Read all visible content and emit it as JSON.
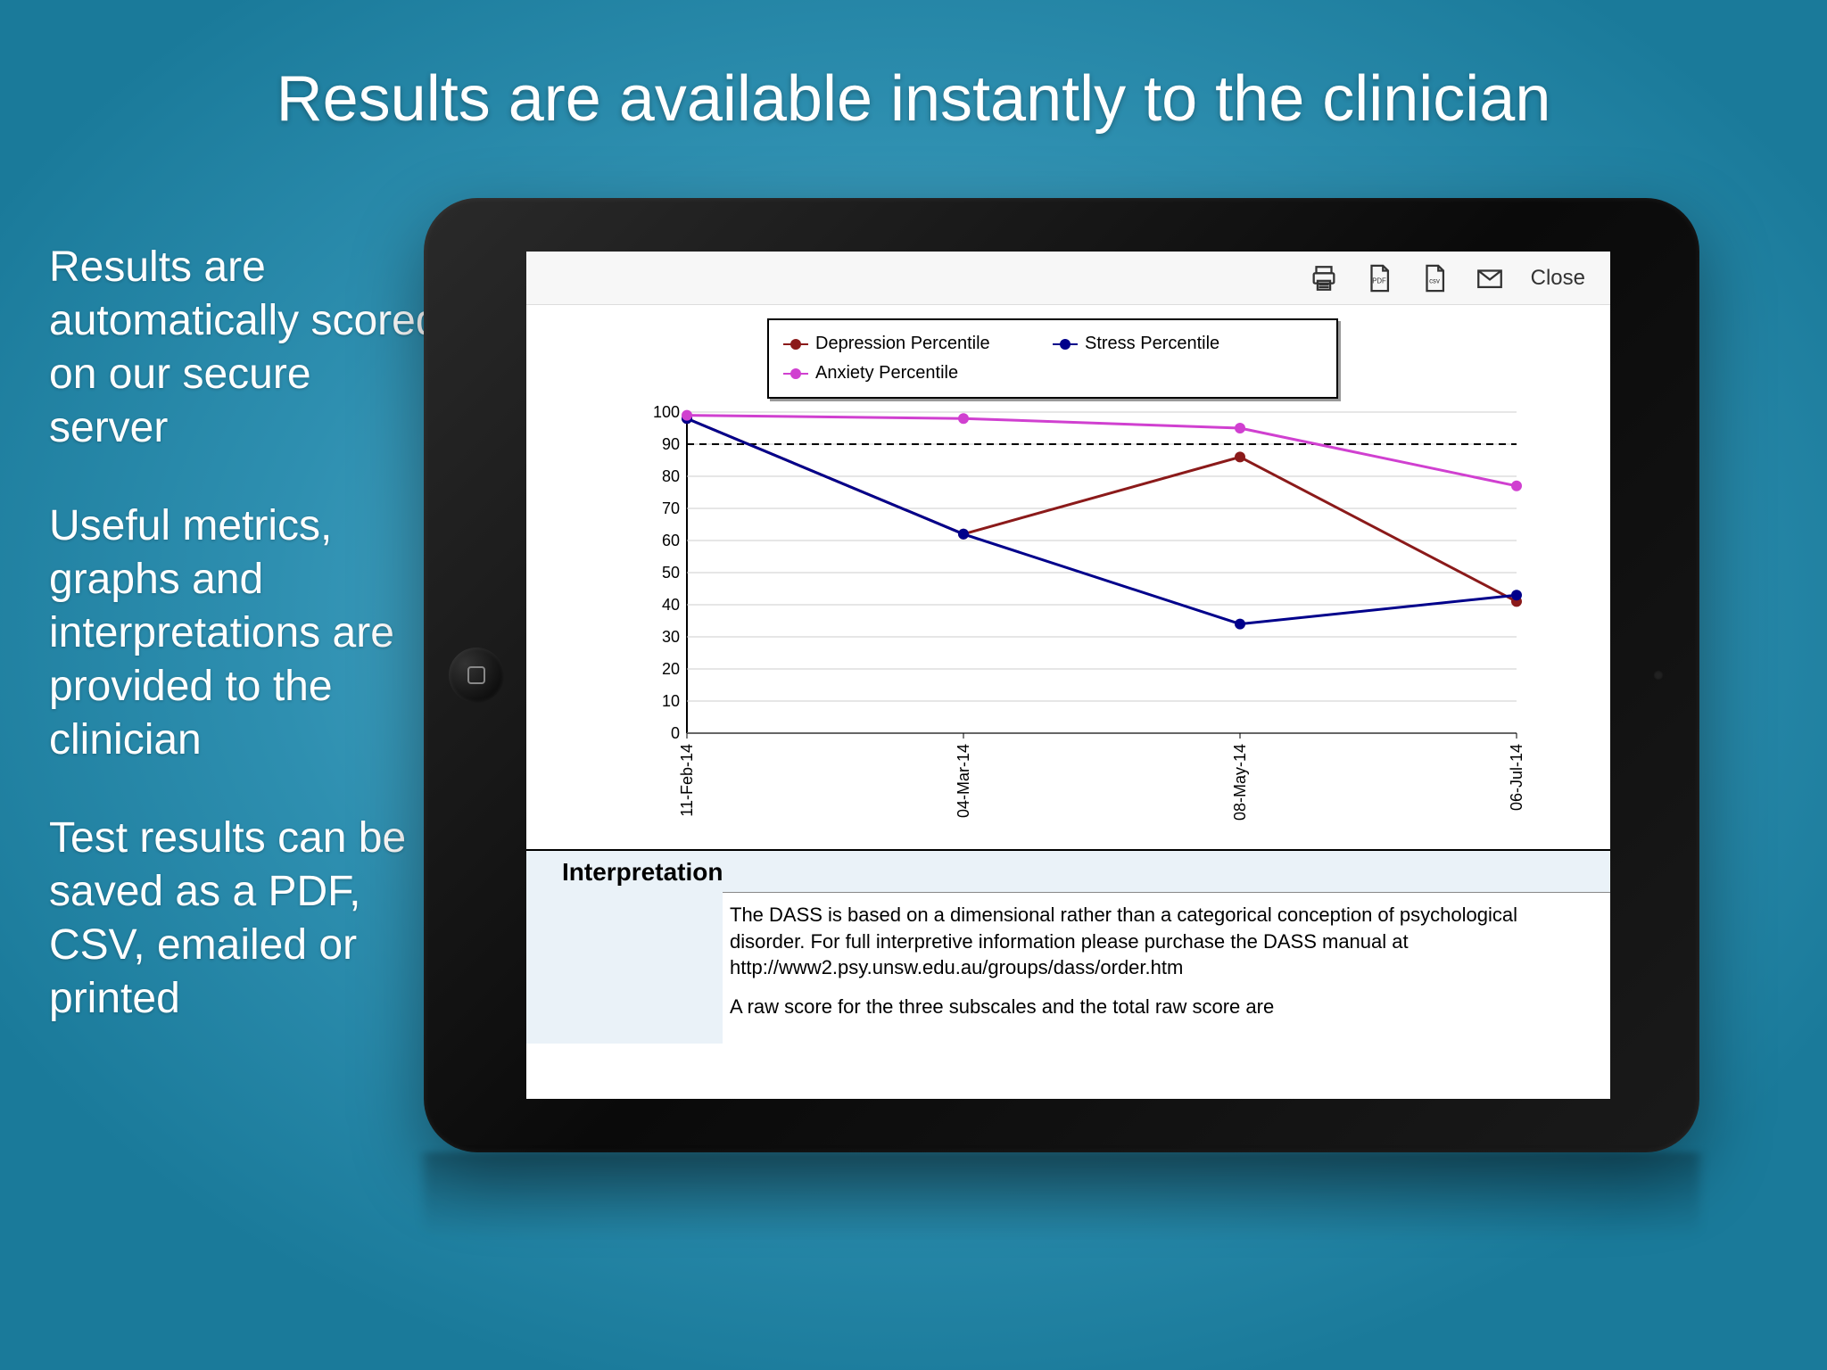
{
  "header": {
    "title": "Results are available instantly to the clinician"
  },
  "side": {
    "p1": "Results are automatically scored on our secure server",
    "p2": "Useful metrics, graphs and interpretations are provided to the clinician",
    "p3": "Test results can be saved as a PDF, CSV, emailed or printed"
  },
  "toolbar": {
    "close": "Close"
  },
  "legend": {
    "depression": "Depression Percentile",
    "stress": "Stress Percentile",
    "anxiety": "Anxiety Percentile"
  },
  "interp": {
    "heading": "Interpretation",
    "body1": "The DASS is based on a dimensional rather than a categorical conception of psychological disorder. For full interpretive information please purchase the DASS manual at http://www2.psy.unsw.edu.au/groups/dass/order.htm",
    "body2": "A raw score for the three subscales and the total raw score are"
  },
  "chart_data": {
    "type": "line",
    "categories": [
      "11-Feb-14",
      "04-Mar-14",
      "08-May-14",
      "06-Jul-14"
    ],
    "series": [
      {
        "name": "Depression Percentile",
        "color": "#8b1a1a",
        "values": [
          98,
          62,
          86,
          41
        ]
      },
      {
        "name": "Stress Percentile",
        "color": "#00008b",
        "values": [
          98,
          62,
          34,
          43
        ]
      },
      {
        "name": "Anxiety Percentile",
        "color": "#d040d0",
        "values": [
          99,
          98,
          95,
          77
        ]
      }
    ],
    "ylim": [
      0,
      100
    ],
    "yticks": [
      0,
      10,
      20,
      30,
      40,
      50,
      60,
      70,
      80,
      90,
      100
    ],
    "reference_line": 90,
    "xlabel": "",
    "ylabel": ""
  }
}
